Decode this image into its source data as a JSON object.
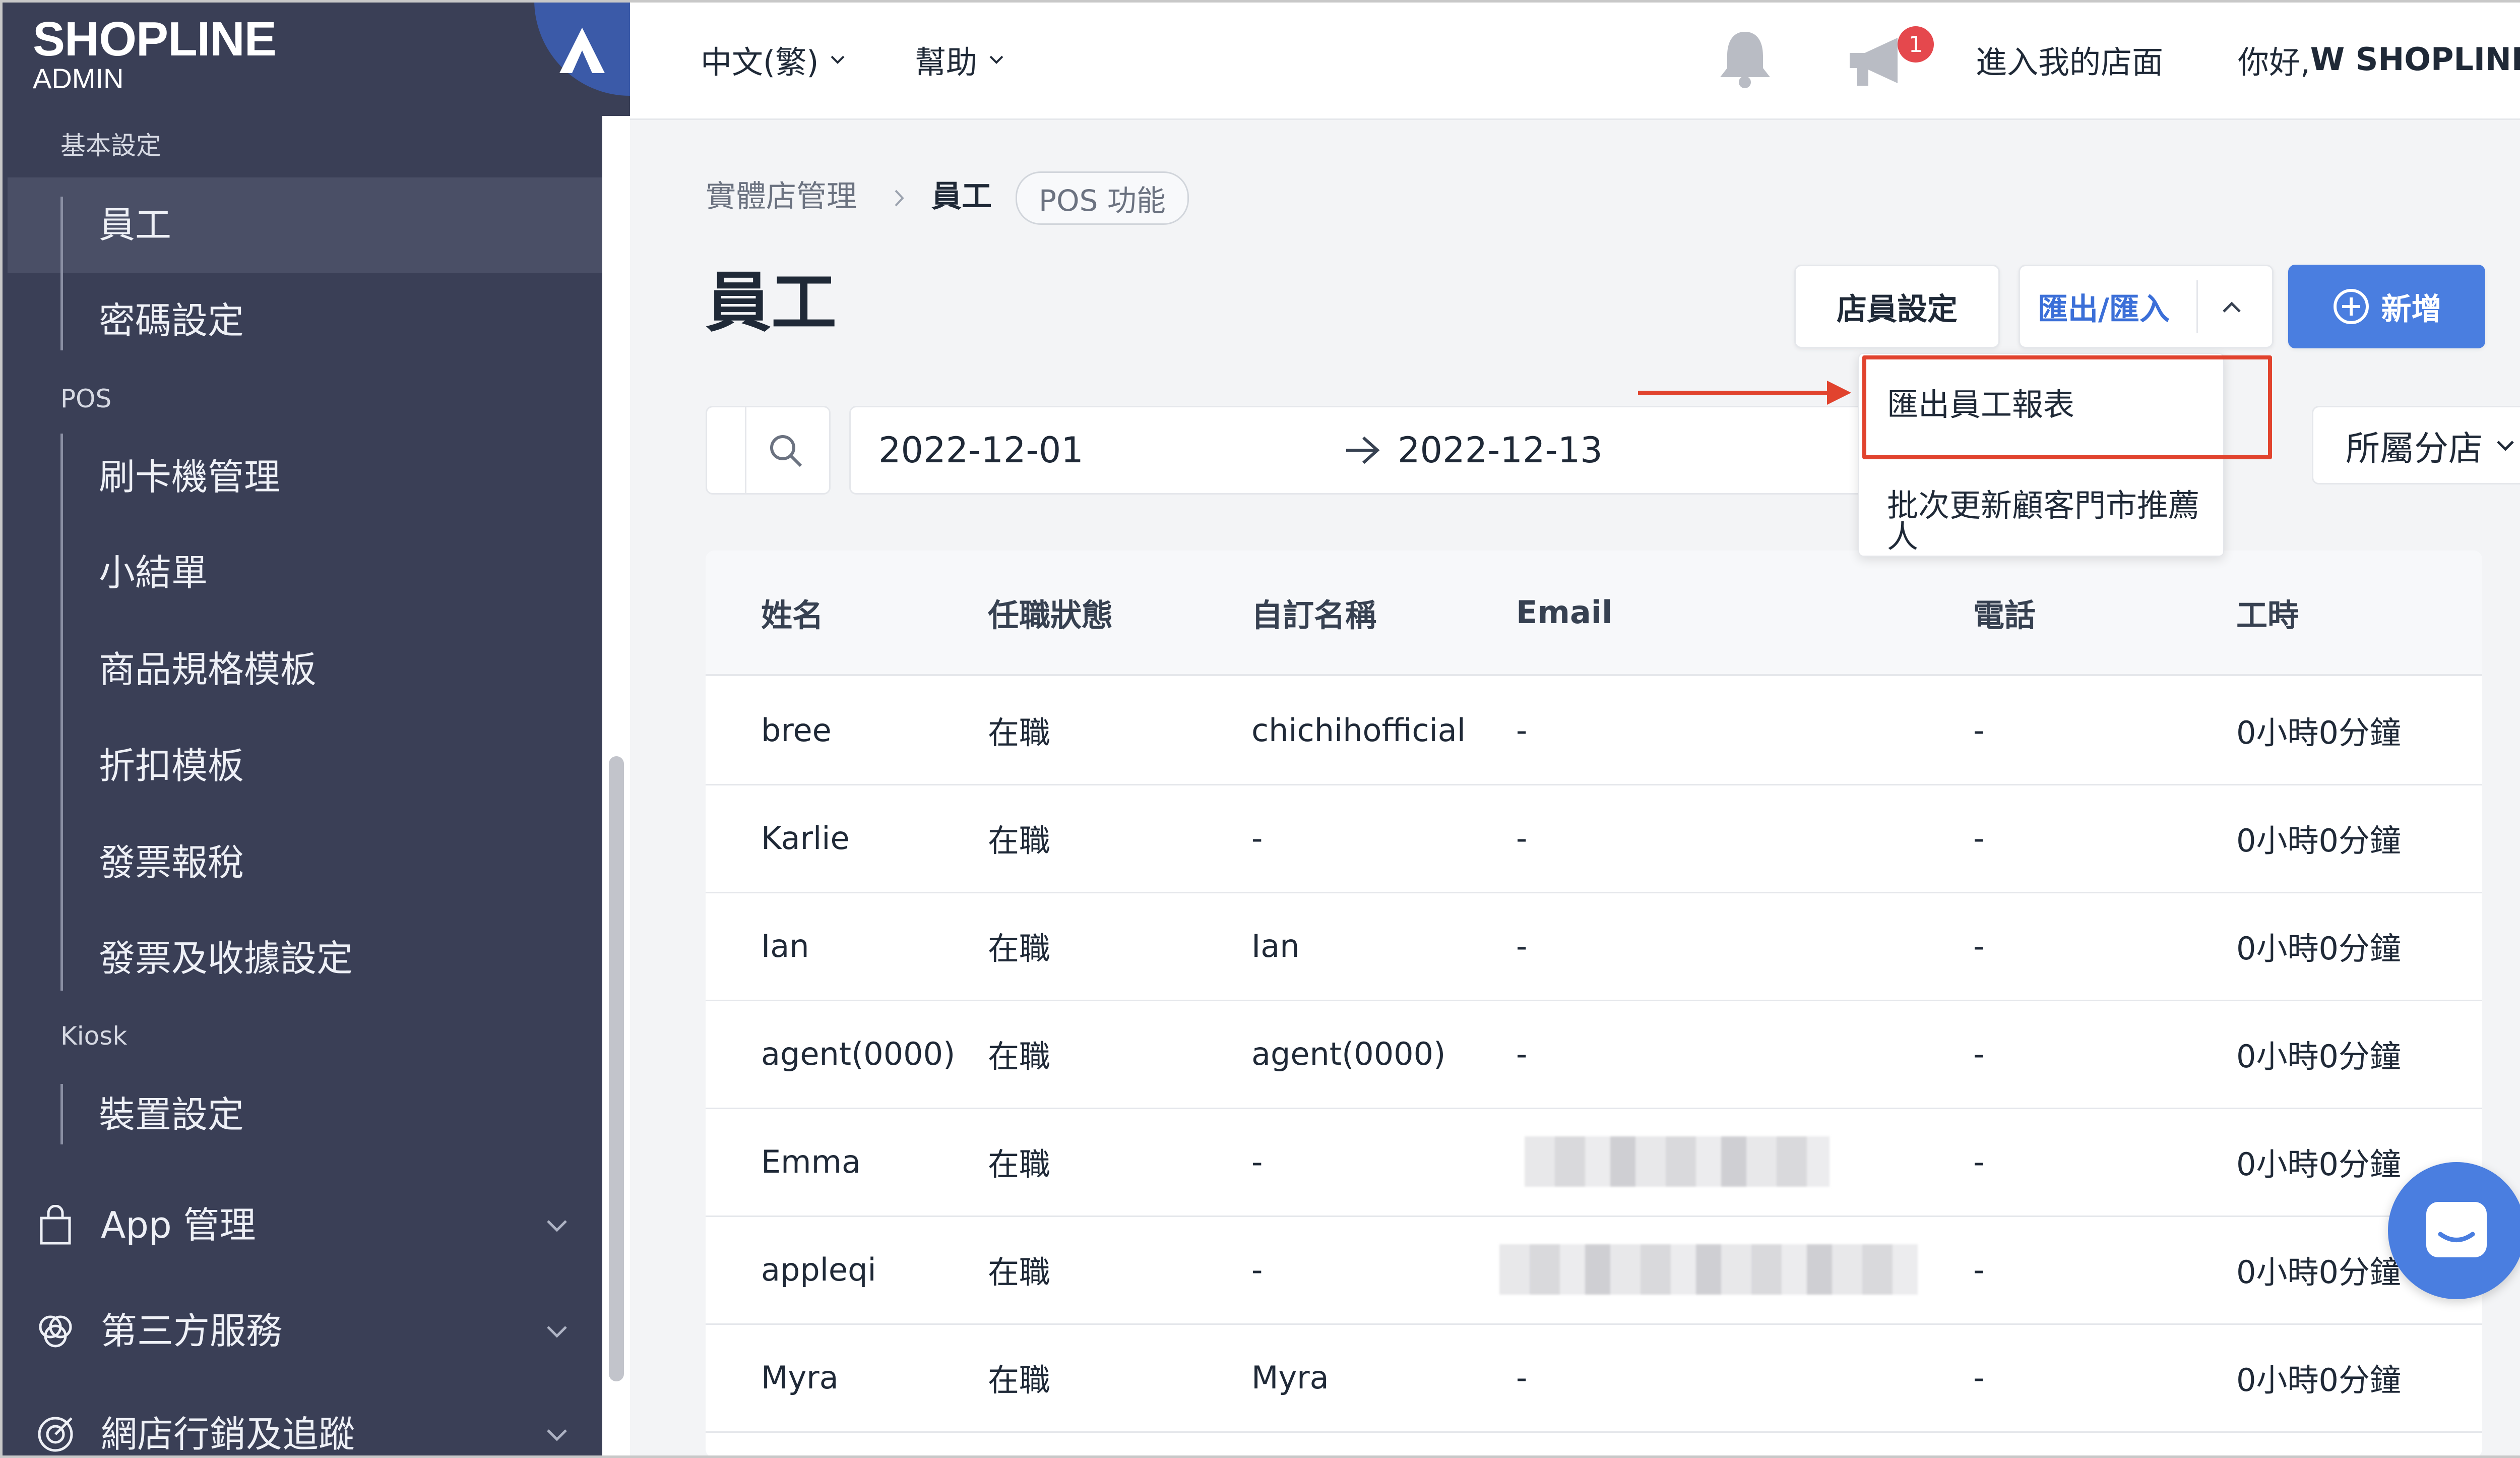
{
  "brand": {
    "name": "SHOPLINE",
    "sub": "ADMIN"
  },
  "sidebar": {
    "groups": [
      {
        "label": "基本設定",
        "items": [
          "員工",
          "密碼設定"
        ]
      },
      {
        "label": "POS",
        "items": [
          "刷卡機管理",
          "小結單",
          "商品規格模板",
          "折扣模板",
          "發票報稅",
          "發票及收據設定"
        ]
      },
      {
        "label": "Kiosk",
        "items": [
          "裝置設定"
        ]
      }
    ],
    "active_item": "員工",
    "main_items": [
      {
        "label": "App 管理",
        "icon": "shopping-bag-icon"
      },
      {
        "label": "第三方服務",
        "icon": "three-circles-icon"
      },
      {
        "label": "網店行銷及追蹤",
        "icon": "target-icon"
      }
    ]
  },
  "topbar": {
    "language": "中文(繁)",
    "help": "幫助",
    "notification_icon": "bell-icon",
    "announcement_icon": "megaphone-icon",
    "announcement_count": "1",
    "visit_store": "進入我的店面",
    "greeting_prefix": "你好, ",
    "greeting_name": "W SHOPLINE"
  },
  "breadcrumb": {
    "parent": "實體店管理",
    "current": "員工",
    "tag": "POS 功能"
  },
  "page": {
    "title": "員工"
  },
  "actions": {
    "staff_settings": "店員設定",
    "export_import": "匯出/匯入",
    "add": "新增"
  },
  "dropdown": {
    "items": [
      "匯出員工報表",
      "批次更新顧客門市推薦人"
    ]
  },
  "filters": {
    "search_icon": "search-icon",
    "date_from": "2022-12-01",
    "date_to": "2022-12-13",
    "branch": "所屬分店"
  },
  "table": {
    "columns": [
      "姓名",
      "任職狀態",
      "自訂名稱",
      "Email",
      "電話",
      "工時"
    ],
    "rows": [
      {
        "name": "bree",
        "status": "在職",
        "custom_name": "chichihofficial",
        "email": "-",
        "phone": "-",
        "hours": "0小時0分鐘"
      },
      {
        "name": "Karlie",
        "status": "在職",
        "custom_name": "-",
        "email": "-",
        "phone": "-",
        "hours": "0小時0分鐘"
      },
      {
        "name": "Ian",
        "status": "在職",
        "custom_name": "Ian",
        "email": "-",
        "phone": "-",
        "hours": "0小時0分鐘"
      },
      {
        "name": "agent(0000)",
        "status": "在職",
        "custom_name": "agent(0000)",
        "email": "-",
        "phone": "-",
        "hours": "0小時0分鐘"
      },
      {
        "name": "Emma",
        "status": "在職",
        "custom_name": "-",
        "email": "",
        "phone": "-",
        "hours": "0小時0分鐘"
      },
      {
        "name": "appleqi",
        "status": "在職",
        "custom_name": "-",
        "email": "",
        "phone": "-",
        "hours": "0小時0分鐘"
      },
      {
        "name": "Myra",
        "status": "在職",
        "custom_name": "Myra",
        "email": "-",
        "phone": "-",
        "hours": "0小時0分鐘"
      }
    ]
  },
  "colors": {
    "sidebar": "#3a3f56",
    "accent": "#4a7ee0",
    "annotation": "#e1432e",
    "badge": "#e5484d"
  }
}
